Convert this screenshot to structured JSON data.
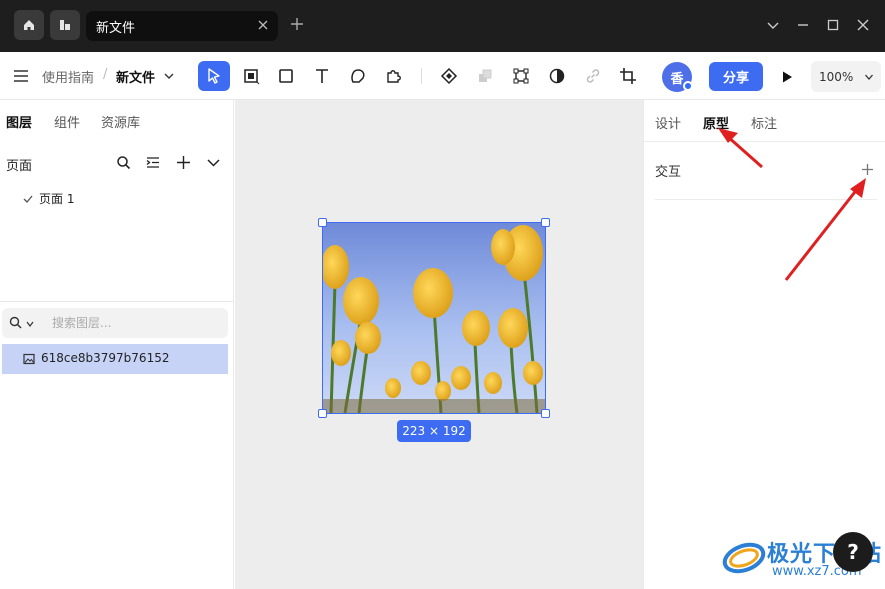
{
  "titlebar": {
    "tab_title": "新文件"
  },
  "toolbar": {
    "breadcrumb_parent": "使用指南",
    "breadcrumb_sep": "/",
    "file_name": "新文件",
    "avatar_initial": "香",
    "share_label": "分享",
    "zoom_level": "100%"
  },
  "left_panel": {
    "tabs": [
      "图层",
      "组件",
      "资源库"
    ],
    "pages_title": "页面",
    "page_item": "页面 1",
    "search_placeholder": "搜索图层...",
    "layer_name": "618ce8b3797b76152"
  },
  "canvas": {
    "dimensions": "223 × 192"
  },
  "right_panel": {
    "tabs": [
      "设计",
      "原型",
      "标注"
    ],
    "active_tab": "原型",
    "interaction_title": "交互"
  },
  "watermark": {
    "text": "极光下载站",
    "url": "www.xz7.com"
  },
  "help_label": "?",
  "colors": {
    "accent": "#3d6cf2",
    "titlebar": "#1e1e1e",
    "selected_layer": "#c7d3f6",
    "annotation_arrow": "#e02020"
  }
}
